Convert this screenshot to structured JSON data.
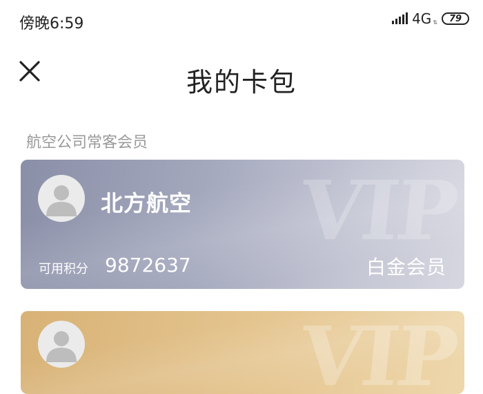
{
  "status_bar": {
    "time": "傍晚6:59",
    "network": "4G",
    "battery": "79"
  },
  "header": {
    "title": "我的卡包"
  },
  "section": {
    "title": "航空公司常客会员"
  },
  "cards": [
    {
      "airline": "北方航空",
      "watermark": "VIP",
      "points_label": "可用积分",
      "points": "9872637",
      "tier": "白金会员"
    },
    {
      "watermark": "VIP"
    }
  ]
}
